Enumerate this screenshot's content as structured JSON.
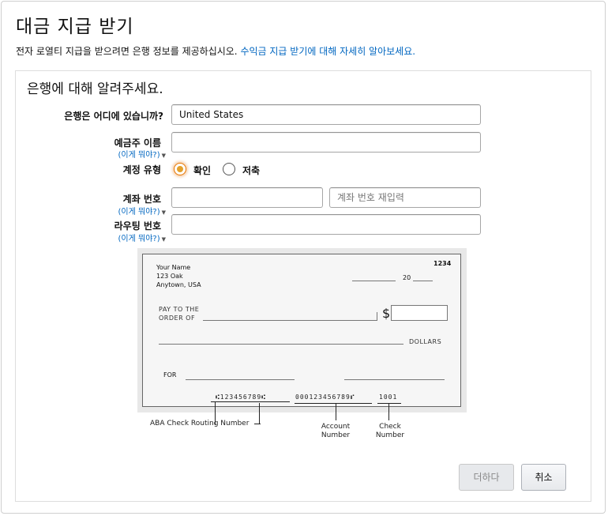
{
  "page": {
    "title": "대금 지급 받기",
    "subtitle": "전자 로열티 지급을 받으려면 은행 정보를 제공하십시오.",
    "learn_more_link": "수익금 지급 받기에 대해 자세히 알아보세요."
  },
  "form": {
    "section_title": "은행에 대해 알려주세요.",
    "bank_location": {
      "label": "은행은 어디에 있습니까?",
      "value": "United States"
    },
    "account_holder": {
      "label": "예금주 이름",
      "help": "(이게 뭐야?)",
      "value": ""
    },
    "account_type": {
      "label": "계정 유형",
      "options": [
        {
          "label": "확인",
          "selected": true
        },
        {
          "label": "저축",
          "selected": false
        }
      ]
    },
    "account_number": {
      "label": "계좌 번호",
      "help": "(이게 뭐야?)",
      "value": "",
      "reenter_placeholder": "계좌 번호 재입력"
    },
    "routing_number": {
      "label": "라우팅 번호",
      "help": "(이게 뭐야?)",
      "value": ""
    }
  },
  "check_image": {
    "name": "Your Name",
    "street": "123 Oak",
    "city": "Anytown, USA",
    "check_no": "1234",
    "date_prefix": "20",
    "pay_to_line1": "PAY TO THE",
    "pay_to_line2": "ORDER OF",
    "dollar_sign": "$",
    "dollars": "DOLLARS",
    "for": "FOR",
    "micr_routing": "⑆123456789⑆",
    "micr_account": "000123456789⑈",
    "micr_check": "1001",
    "ann_routing": "ABA Check Routing Number",
    "ann_account_1": "Account",
    "ann_account_2": "Number",
    "ann_check_1": "Check",
    "ann_check_2": "Number"
  },
  "buttons": {
    "add": "더하다",
    "cancel": "취소"
  },
  "colors": {
    "link": "#0066c0",
    "radio_accent": "#e77600"
  },
  "icons": {
    "help_caret": "caret-down-icon"
  }
}
